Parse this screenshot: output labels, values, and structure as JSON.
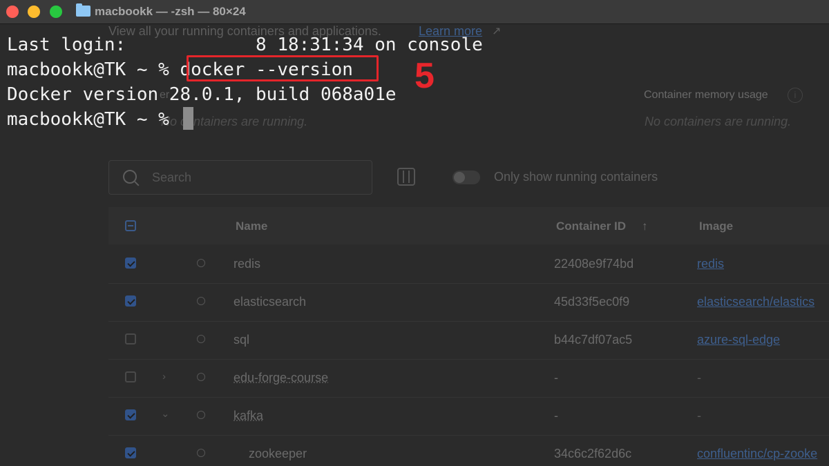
{
  "window": {
    "title": "macbookk — -zsh — 80×24",
    "traffic_lights": {
      "close": "#fe5f57",
      "minimize": "#febc2e",
      "zoom": "#28c840"
    }
  },
  "terminal": {
    "lines": [
      "Last login:            8 18:31:34 on console",
      "macbookk@TK ~ % ",
      "Docker version 28.0.1, build 068a01e",
      "macbookk@TK ~ % "
    ],
    "command": "docker --version",
    "annotation_number": "5"
  },
  "background_app": {
    "subtitle": "View all your running containers and applications.",
    "learn_more": "Learn more",
    "cpu_label": "er",
    "no_containers_left": "No containers are running.",
    "memory_label": "Container memory usage",
    "no_containers_right": "No containers are running.",
    "search_placeholder": "Search",
    "toggle_label": "Only show running containers",
    "columns": {
      "name": "Name",
      "container_id": "Container ID",
      "image": "Image"
    },
    "rows": [
      {
        "name": "redis",
        "container_id": "22408e9f74bd",
        "image": "redis",
        "checked": true
      },
      {
        "name": "elasticsearch",
        "container_id": "45d33f5ec0f9",
        "image": "elasticsearch/elastics",
        "checked": true
      },
      {
        "name": "sql",
        "container_id": "b44c7df07ac5",
        "image": "azure-sql-edge",
        "checked": false
      },
      {
        "name": "edu-forge-course",
        "container_id": "-",
        "image": "-",
        "checked": false
      },
      {
        "name": "kafka",
        "container_id": "-",
        "image": "-",
        "checked": true
      },
      {
        "name": "zookeeper",
        "container_id": "34c6c2f62d6c",
        "image": "confluentinc/cp-zooke",
        "checked": true
      }
    ]
  }
}
